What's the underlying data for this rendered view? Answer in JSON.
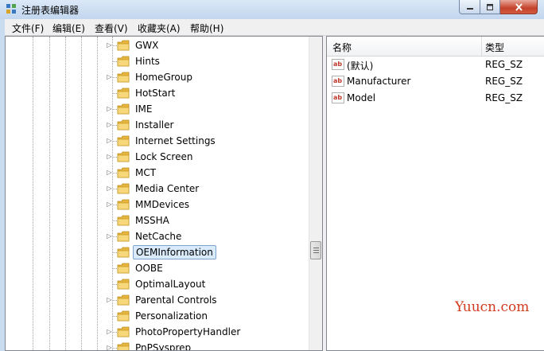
{
  "window": {
    "title": "注册表编辑器",
    "icon": "registry-editor-icon"
  },
  "menu": [
    {
      "label": "文件(F)"
    },
    {
      "label": "编辑(E)"
    },
    {
      "label": "查看(V)"
    },
    {
      "label": "收藏夹(A)"
    },
    {
      "label": "帮助(H)"
    }
  ],
  "tree": {
    "items": [
      {
        "label": "GWX",
        "expandable": true
      },
      {
        "label": "Hints",
        "expandable": false
      },
      {
        "label": "HomeGroup",
        "expandable": true
      },
      {
        "label": "HotStart",
        "expandable": false
      },
      {
        "label": "IME",
        "expandable": true
      },
      {
        "label": "Installer",
        "expandable": true
      },
      {
        "label": "Internet Settings",
        "expandable": true
      },
      {
        "label": "Lock Screen",
        "expandable": true
      },
      {
        "label": "MCT",
        "expandable": true
      },
      {
        "label": "Media Center",
        "expandable": true
      },
      {
        "label": "MMDevices",
        "expandable": true
      },
      {
        "label": "MSSHA",
        "expandable": false
      },
      {
        "label": "NetCache",
        "expandable": true
      },
      {
        "label": "OEMInformation",
        "expandable": false,
        "selected": true
      },
      {
        "label": "OOBE",
        "expandable": false
      },
      {
        "label": "OptimalLayout",
        "expandable": false
      },
      {
        "label": "Parental Controls",
        "expandable": true
      },
      {
        "label": "Personalization",
        "expandable": false
      },
      {
        "label": "PhotoPropertyHandler",
        "expandable": true
      },
      {
        "label": "PnPSysprep",
        "expandable": true
      }
    ]
  },
  "list": {
    "columns": {
      "name": "名称",
      "type": "类型"
    },
    "rows": [
      {
        "name": "(默认)",
        "type": "REG_SZ",
        "icon": "string-value-icon"
      },
      {
        "name": "Manufacturer",
        "type": "REG_SZ",
        "icon": "string-value-icon"
      },
      {
        "name": "Model",
        "type": "REG_SZ",
        "icon": "string-value-icon"
      }
    ]
  },
  "watermark": "Yuucn.com",
  "colors": {
    "selection_bg": "#d9ebfb",
    "selection_border": "#7da2ce",
    "folder": "#f2c94c",
    "close_button": "#c4422b",
    "watermark": "#d23a1e"
  }
}
